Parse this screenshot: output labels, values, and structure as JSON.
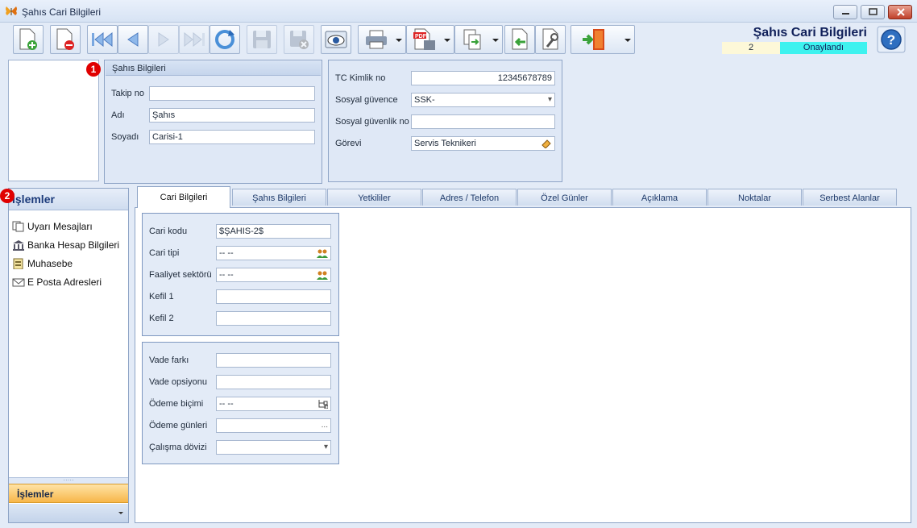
{
  "window": {
    "title": "Şahıs Cari Bilgileri",
    "controls": [
      "minimize",
      "maximize",
      "close"
    ]
  },
  "header": {
    "title": "Şahıs Cari Bilgileri",
    "record_number": "2",
    "record_status": "Onaylandı",
    "status_color": "#3ef2ef"
  },
  "toolbar": {
    "buttons": [
      {
        "name": "new-record",
        "icon": "new-document-icon"
      },
      {
        "name": "delete-record",
        "icon": "delete-document-icon"
      },
      {
        "name": "first-record",
        "icon": "first-icon"
      },
      {
        "name": "previous-record",
        "icon": "previous-icon"
      },
      {
        "name": "next-record",
        "icon": "next-icon"
      },
      {
        "name": "last-record",
        "icon": "last-icon"
      },
      {
        "name": "refresh",
        "icon": "refresh-icon"
      },
      {
        "name": "save",
        "icon": "save-icon"
      },
      {
        "name": "save-close",
        "icon": "save-cancel-icon"
      },
      {
        "name": "preview",
        "icon": "eye-icon"
      },
      {
        "name": "print",
        "icon": "printer-icon"
      },
      {
        "name": "export-pdf",
        "icon": "pdf-icon"
      },
      {
        "name": "copy",
        "icon": "copy-icon"
      },
      {
        "name": "import",
        "icon": "import-icon"
      },
      {
        "name": "tools",
        "icon": "wrench-icon"
      },
      {
        "name": "exit",
        "icon": "exit-door-icon"
      }
    ]
  },
  "person_panel": {
    "badge": "1",
    "caption": "Şahıs Bilgileri",
    "takip_no_label": "Takip no",
    "takip_no_value": "",
    "adi_label": "Adı",
    "adi_value": "Şahıs",
    "soyadi_label": "Soyadı",
    "soyadi_value": "Carisi-1"
  },
  "identity_panel": {
    "tc_label": "TC Kimlik no",
    "tc_value": "12345678789",
    "sosyal_guvence_label": "Sosyal güvence",
    "sosyal_guvence_value": "SSK-",
    "sosyal_guvenlik_no_label": "Sosyal güvenlik no",
    "sosyal_guvenlik_no_value": "",
    "gorevi_label": "Görevi",
    "gorevi_value": "Servis Teknikeri"
  },
  "nav": {
    "badge": "2",
    "header": "İşlemler",
    "items": [
      {
        "label": "Uyarı Mesajları",
        "icon": "messages-icon"
      },
      {
        "label": "Banka Hesap Bilgileri",
        "icon": "bank-icon"
      },
      {
        "label": "Muhasebe",
        "icon": "ledger-icon"
      },
      {
        "label": "E Posta Adresleri",
        "icon": "envelope-icon"
      }
    ],
    "active_group": "İşlemler"
  },
  "tabs": [
    {
      "label": "Cari Bilgileri",
      "active": true
    },
    {
      "label": "Şahıs Bilgileri",
      "active": false
    },
    {
      "label": "Yetkililer",
      "active": false
    },
    {
      "label": "Adres / Telefon",
      "active": false
    },
    {
      "label": "Özel Günler",
      "active": false
    },
    {
      "label": "Açıklama",
      "active": false
    },
    {
      "label": "Noktalar",
      "active": false
    },
    {
      "label": "Serbest Alanlar",
      "active": false
    }
  ],
  "cari_group": {
    "cari_kodu_label": "Cari kodu",
    "cari_kodu_value": "$ŞAHIS-2$",
    "cari_tipi_label": "Cari tipi",
    "cari_tipi_value": "-- --",
    "faaliyet_label": "Faaliyet sektörü",
    "faaliyet_value": "-- --",
    "kefil1_label": "Kefil 1",
    "kefil1_value": "",
    "kefil2_label": "Kefil 2",
    "kefil2_value": ""
  },
  "payment_group": {
    "vade_farki_label": "Vade farkı",
    "vade_farki_value": "",
    "vade_opsiyonu_label": "Vade opsiyonu",
    "vade_opsiyonu_value": "",
    "odeme_bicimi_label": "Ödeme biçimi",
    "odeme_bicimi_value": "-- --",
    "odeme_gunleri_label": "Ödeme günleri",
    "odeme_gunleri_value": "",
    "odeme_gunleri_button": "...",
    "calisma_dovizi_label": "Çalışma dövizi",
    "calisma_dovizi_value": ""
  }
}
